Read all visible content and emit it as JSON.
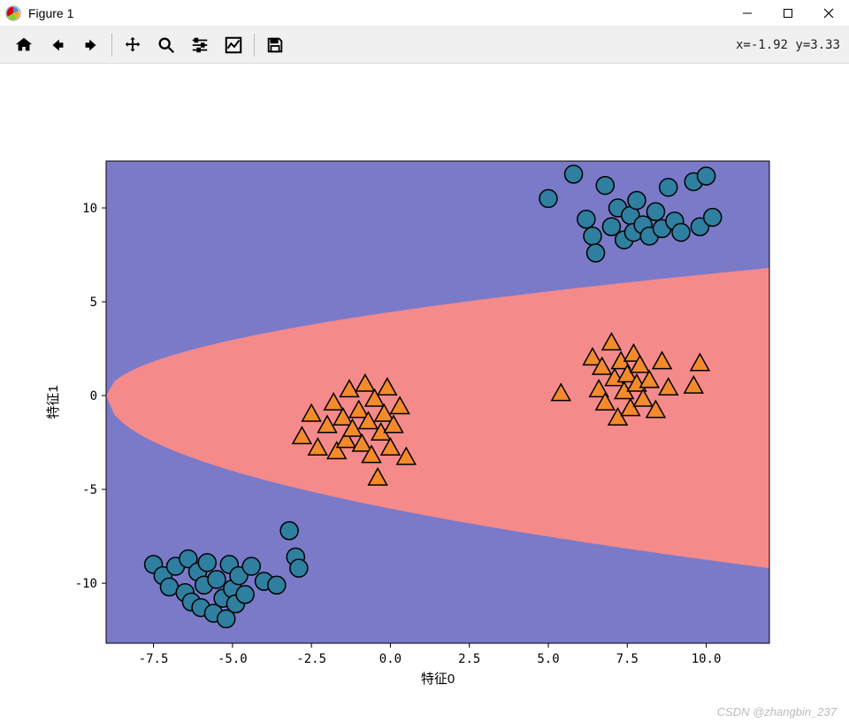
{
  "window": {
    "title": "Figure 1"
  },
  "toolbar": {
    "items": [
      "home",
      "back",
      "forward",
      "sep",
      "pan",
      "zoom",
      "configure",
      "edit",
      "sep",
      "save"
    ],
    "coord_readout": "x=-1.92  y=3.33"
  },
  "watermark": "CSDN @zhangbin_237",
  "chart_data": {
    "type": "scatter",
    "xlabel": "特征0",
    "ylabel": "特征1",
    "xlim": [
      -9,
      12
    ],
    "ylim": [
      -13.2,
      12.5
    ],
    "xticks": [
      -7.5,
      -5.0,
      -2.5,
      0.0,
      2.5,
      5.0,
      7.5,
      10.0
    ],
    "yticks": [
      -10,
      -5,
      0,
      5,
      10
    ],
    "xtick_labels": [
      "-7.5",
      "-5.0",
      "-2.5",
      "0.0",
      "2.5",
      "5.0",
      "7.5",
      "10.0"
    ],
    "ytick_labels": [
      "-10",
      "-5",
      "0",
      "5",
      "10"
    ],
    "background_region": {
      "description": "parabolic decision boundary: class-1 (salmon) inside ellipse-parabola opening right from x≈-9, ±0 widening to ±9 at x=12; class-0 (purple) outside",
      "colors": {
        "class0": "#7a7ac9",
        "class1": "#f58a8a"
      }
    },
    "series": [
      {
        "name": "class-0",
        "marker": "circle",
        "color": "#2f7fa1",
        "edge": "#000",
        "points": [
          [
            -7.5,
            -9.0
          ],
          [
            -7.2,
            -9.6
          ],
          [
            -7.0,
            -10.2
          ],
          [
            -6.8,
            -9.1
          ],
          [
            -6.5,
            -10.5
          ],
          [
            -6.4,
            -8.7
          ],
          [
            -6.3,
            -11.0
          ],
          [
            -6.1,
            -9.4
          ],
          [
            -6.0,
            -11.3
          ],
          [
            -5.9,
            -10.1
          ],
          [
            -5.8,
            -8.9
          ],
          [
            -5.6,
            -11.6
          ],
          [
            -5.5,
            -9.8
          ],
          [
            -5.3,
            -10.8
          ],
          [
            -5.2,
            -11.9
          ],
          [
            -5.1,
            -9.0
          ],
          [
            -5.0,
            -10.3
          ],
          [
            -4.9,
            -11.1
          ],
          [
            -4.8,
            -9.6
          ],
          [
            -4.6,
            -10.6
          ],
          [
            -4.4,
            -9.1
          ],
          [
            -4.0,
            -9.9
          ],
          [
            -3.6,
            -10.1
          ],
          [
            -3.2,
            -7.2
          ],
          [
            -3.0,
            -8.6
          ],
          [
            -2.9,
            -9.2
          ],
          [
            5.0,
            10.5
          ],
          [
            5.8,
            11.8
          ],
          [
            6.2,
            9.4
          ],
          [
            6.4,
            8.5
          ],
          [
            6.5,
            7.6
          ],
          [
            6.8,
            11.2
          ],
          [
            7.0,
            9.0
          ],
          [
            7.2,
            10.0
          ],
          [
            7.4,
            8.3
          ],
          [
            7.6,
            9.6
          ],
          [
            7.7,
            8.7
          ],
          [
            7.8,
            10.4
          ],
          [
            8.0,
            9.1
          ],
          [
            8.2,
            8.5
          ],
          [
            8.4,
            9.8
          ],
          [
            8.6,
            8.9
          ],
          [
            8.8,
            11.1
          ],
          [
            9.0,
            9.3
          ],
          [
            9.2,
            8.7
          ],
          [
            9.6,
            11.4
          ],
          [
            9.8,
            9.0
          ],
          [
            10.0,
            11.7
          ],
          [
            10.2,
            9.5
          ]
        ]
      },
      {
        "name": "class-1",
        "marker": "triangle",
        "color": "#f48a2a",
        "edge": "#000",
        "points": [
          [
            -2.8,
            -2.2
          ],
          [
            -2.5,
            -1.0
          ],
          [
            -2.3,
            -2.8
          ],
          [
            -2.0,
            -1.6
          ],
          [
            -1.8,
            -0.4
          ],
          [
            -1.7,
            -3.0
          ],
          [
            -1.5,
            -1.2
          ],
          [
            -1.4,
            -2.4
          ],
          [
            -1.3,
            0.3
          ],
          [
            -1.2,
            -1.8
          ],
          [
            -1.0,
            -0.8
          ],
          [
            -0.9,
            -2.6
          ],
          [
            -0.8,
            0.6
          ],
          [
            -0.7,
            -1.4
          ],
          [
            -0.6,
            -3.2
          ],
          [
            -0.5,
            -0.2
          ],
          [
            -0.3,
            -2.0
          ],
          [
            -0.2,
            -1.0
          ],
          [
            -0.1,
            0.4
          ],
          [
            0.0,
            -2.8
          ],
          [
            0.1,
            -1.6
          ],
          [
            0.3,
            -0.6
          ],
          [
            0.5,
            -3.3
          ],
          [
            -0.4,
            -4.4
          ],
          [
            5.4,
            0.1
          ],
          [
            6.4,
            2.0
          ],
          [
            6.6,
            0.3
          ],
          [
            6.7,
            1.5
          ],
          [
            6.8,
            -0.4
          ],
          [
            7.0,
            2.8
          ],
          [
            7.1,
            0.9
          ],
          [
            7.2,
            -1.2
          ],
          [
            7.3,
            1.8
          ],
          [
            7.4,
            0.2
          ],
          [
            7.5,
            1.1
          ],
          [
            7.6,
            -0.7
          ],
          [
            7.7,
            2.2
          ],
          [
            7.8,
            0.6
          ],
          [
            7.9,
            1.6
          ],
          [
            8.0,
            -0.2
          ],
          [
            8.2,
            0.8
          ],
          [
            8.4,
            -0.8
          ],
          [
            8.6,
            1.8
          ],
          [
            8.8,
            0.4
          ],
          [
            9.8,
            1.7
          ],
          [
            9.6,
            0.5
          ]
        ]
      }
    ]
  }
}
